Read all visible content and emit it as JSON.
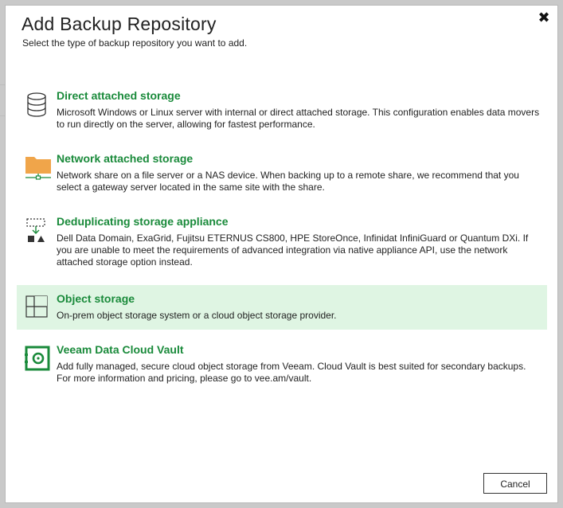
{
  "dialog": {
    "title": "Add Backup Repository",
    "subtitle": "Select the type of backup repository you want to add.",
    "close_glyph": "✖",
    "cancel_label": "Cancel"
  },
  "options": [
    {
      "title": "Direct attached storage",
      "description": "Microsoft Windows or Linux server with internal or direct attached storage. This configuration enables data movers to run directly on the server, allowing for fastest performance.",
      "icon": "database-icon"
    },
    {
      "title": "Network attached storage",
      "description": "Network share on a file server or a NAS device. When backing up to a remote share, we recommend that you select a gateway server located in the same site with the share.",
      "icon": "network-folder-icon"
    },
    {
      "title": "Deduplicating storage appliance",
      "description": "Dell Data Domain, ExaGrid, Fujitsu ETERNUS CS800, HPE StoreOnce, Infinidat InfiniGuard or Quantum DXi. If you are unable to meet the requirements of advanced integration via native appliance API, use the network attached storage option instead.",
      "icon": "deduplication-icon"
    },
    {
      "title": "Object storage",
      "description": "On-prem object storage system or a cloud object storage provider.",
      "icon": "object-storage-icon",
      "selected": true
    },
    {
      "title": "Veeam Data Cloud Vault",
      "description": "Add fully managed, secure cloud object storage from Veeam. Cloud Vault is best suited for secondary backups. For more information and pricing, please go to vee.am/vault.",
      "icon": "vault-icon"
    }
  ],
  "colors": {
    "accent_green": "#198a3a",
    "selected_bg": "#dff5e3",
    "folder_orange": "#f0a54a"
  }
}
